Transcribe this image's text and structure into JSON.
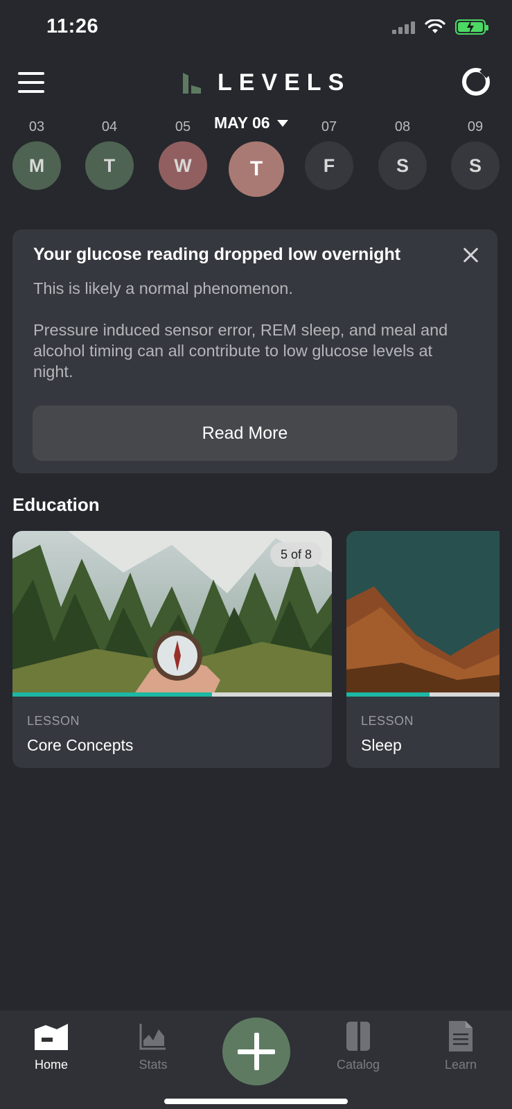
{
  "status_bar": {
    "time": "11:26",
    "icons": [
      "cellular-signal-icon",
      "wifi-icon",
      "battery-charging-icon"
    ],
    "battery_color": "#4cd964"
  },
  "header": {
    "logo_text": "LEVELS",
    "menu_icon": "hamburger-menu-icon",
    "profile_icon": "ring-icon"
  },
  "week": {
    "selected_label": "MAY 06",
    "days": [
      {
        "num": "03",
        "letter": "M",
        "color": "#4e6352"
      },
      {
        "num": "04",
        "letter": "T",
        "color": "#4e6352"
      },
      {
        "num": "05",
        "letter": "W",
        "color": "#915f5f"
      },
      {
        "num": "",
        "letter": "T",
        "color": "#a97a73",
        "selected": true
      },
      {
        "num": "07",
        "letter": "F",
        "color": "#36383d"
      },
      {
        "num": "08",
        "letter": "S",
        "color": "#36383d"
      },
      {
        "num": "09",
        "letter": "S",
        "color": "#36383d"
      }
    ]
  },
  "alert": {
    "title": "Your glucose reading dropped low overnight",
    "body_1": "This is likely a normal phenomenon.",
    "body_2": "Pressure induced sensor error, REM sleep, and meal and alcohol timing can all contribute to low glucose levels at night.",
    "button_label": "Read More"
  },
  "education": {
    "title": "Education",
    "lessons": [
      {
        "kind": "LESSON",
        "title": "Core Concepts",
        "badge": "5 of 8",
        "progress": 0.625,
        "image": "forest-compass-photo"
      },
      {
        "kind": "LESSON",
        "title": "Sleep",
        "badge": "",
        "progress": 0.5,
        "image": "mountain-landscape-photo"
      }
    ]
  },
  "tabs": [
    {
      "label": "Home",
      "icon": "home-icon",
      "active": true
    },
    {
      "label": "Stats",
      "icon": "stats-chart-icon",
      "active": false
    },
    {
      "label": "Catalog",
      "icon": "catalog-icon",
      "active": false
    },
    {
      "label": "Learn",
      "icon": "document-icon",
      "active": false
    }
  ],
  "add_button_icon": "plus-icon",
  "accent_color": "#5e7b62",
  "progress_color": "#1bb8a4"
}
